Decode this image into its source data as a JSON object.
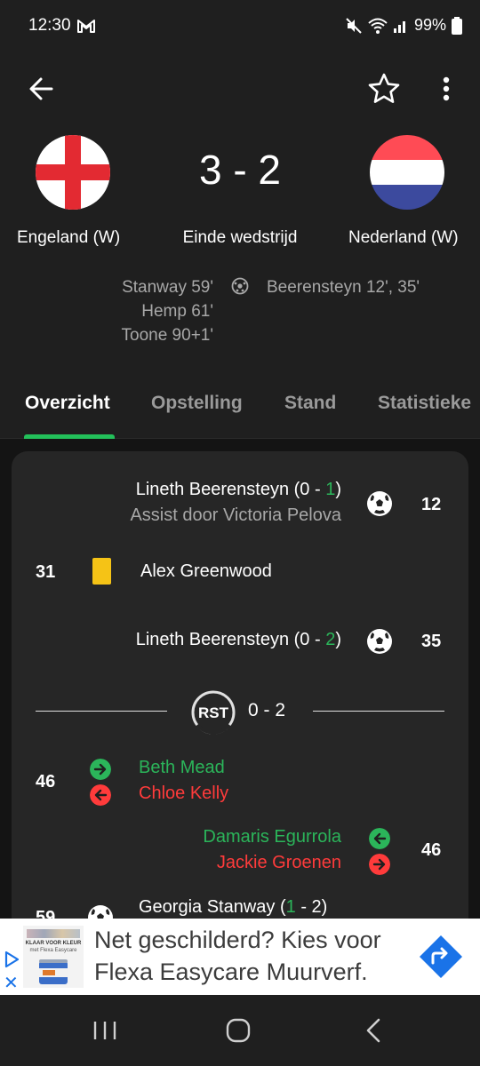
{
  "status": {
    "time": "12:30",
    "battery": "99%"
  },
  "match": {
    "home": {
      "name": "Engeland (W)",
      "scorers": [
        "Stanway 59'",
        "Hemp 61'",
        "Toone 90+1'"
      ]
    },
    "away": {
      "name": "Nederland (W)",
      "scorers": [
        "Beerensteyn 12', 35'"
      ]
    },
    "score": "3 - 2",
    "state": "Einde wedstrijd"
  },
  "tabs": [
    "Overzicht",
    "Opstelling",
    "Stand",
    "Statistieke"
  ],
  "events": {
    "e1": {
      "player": "Lineth Beerensteyn",
      "score_open": "(0 - ",
      "score_hl": "1",
      "score_close": ")",
      "assist": "Assist door Victoria Pelova",
      "minute": "12"
    },
    "e2": {
      "minute": "31",
      "player": "Alex Greenwood"
    },
    "e3": {
      "player": "Lineth Beerensteyn",
      "score_open": "(0 - ",
      "score_hl": "2",
      "score_close": ")",
      "minute": "35"
    },
    "halftime": {
      "badge": "RST",
      "score": "0 - 2"
    },
    "e4": {
      "minute": "46",
      "in": "Beth Mead",
      "out": "Chloe Kelly"
    },
    "e5": {
      "minute": "46",
      "in": "Damaris Egurrola",
      "out": "Jackie Groenen"
    },
    "e6": {
      "minute": "59",
      "player": "Georgia Stanway",
      "score_open": "(",
      "score_hl": "1",
      "score_close": " - 2)"
    }
  },
  "ad": {
    "line1": "Net geschilderd? Kies voor",
    "line2": "Flexa Easycare Muurverf.",
    "thumb_caption1": "KLAAR VOOR KLEUR",
    "thumb_caption2": "met Flexa Easycare"
  },
  "colors": {
    "accent": "#23c05a",
    "sub_in": "#2bb55a",
    "sub_out": "#ff3b3b",
    "yellow_card": "#f5c316"
  }
}
